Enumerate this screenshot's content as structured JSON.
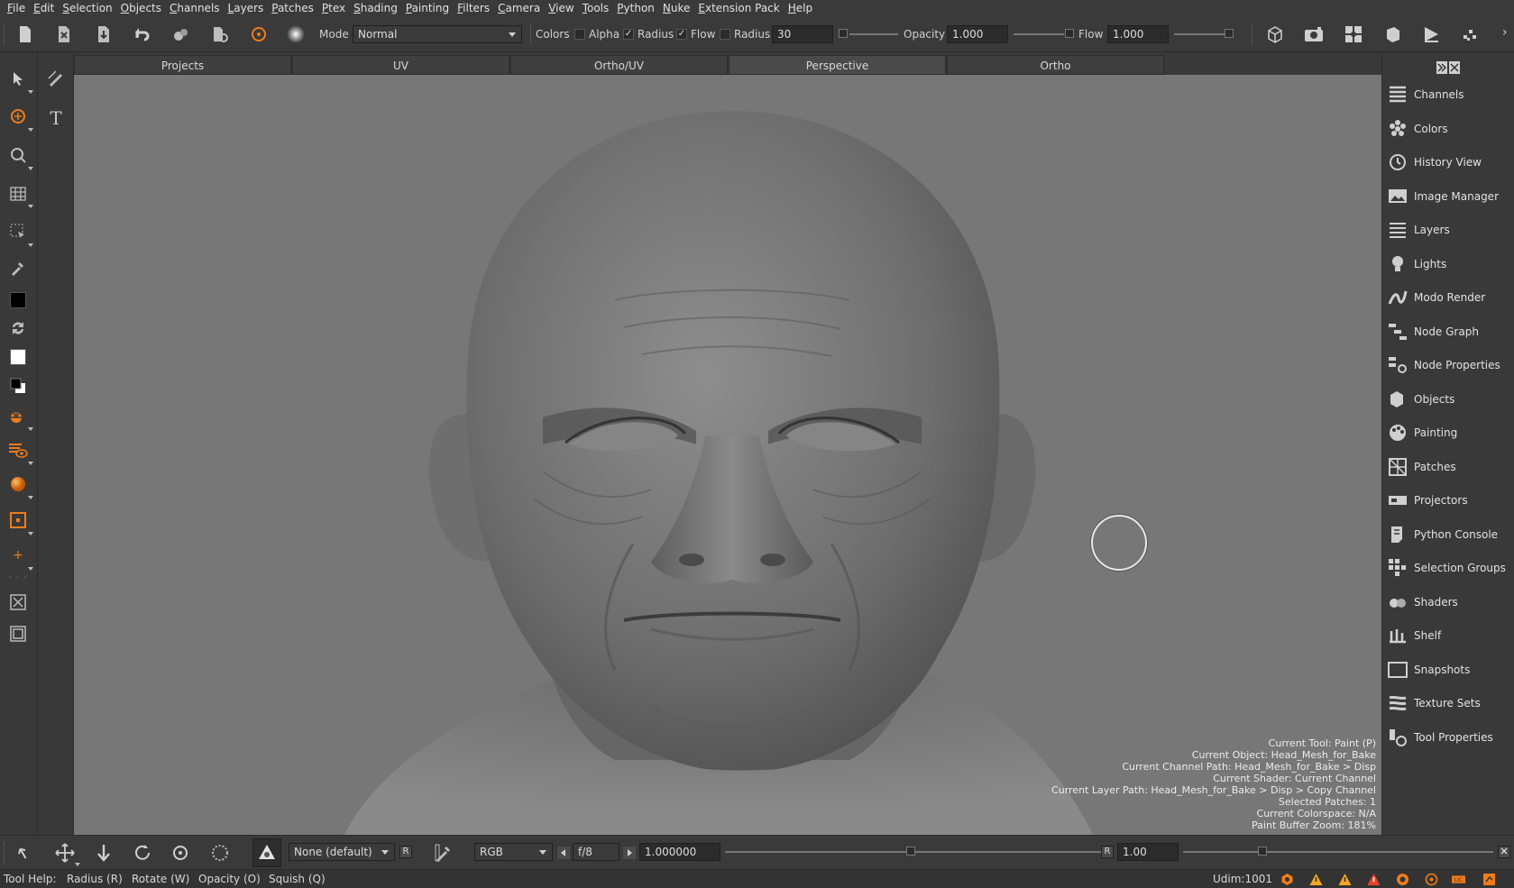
{
  "menu": [
    "File",
    "Edit",
    "Selection",
    "Objects",
    "Channels",
    "Layers",
    "Patches",
    "Ptex",
    "Shading",
    "Painting",
    "Filters",
    "Camera",
    "View",
    "Tools",
    "Python",
    "Nuke",
    "Extension Pack",
    "Help"
  ],
  "toolbar": {
    "mode_label": "Mode",
    "mode_value": "Normal",
    "colors_label": "Colors",
    "alpha_label": "Alpha",
    "radius_chk_label": "Radius",
    "flow_chk_label": "Flow",
    "radius_label": "Radius",
    "radius_value": "30",
    "opacity_label": "Opacity",
    "opacity_value": "1.000",
    "flow_label": "Flow",
    "flow_value": "1.000",
    "alpha_checked": false,
    "radius_checked": true,
    "flow_checked": true
  },
  "tabs": [
    "Projects",
    "UV",
    "Ortho/UV",
    "Perspective",
    "Ortho"
  ],
  "active_tab": "Perspective",
  "hud": [
    "Current Tool: Paint (P)",
    "Current Object: Head_Mesh_for_Bake",
    "Current Channel Path: Head_Mesh_for_Bake > Disp",
    "Current Shader: Current Channel",
    "Current Layer Path: Head_Mesh_for_Bake > Disp > Copy Channel",
    "Selected Patches: 1",
    "Current Colorspace: N/A",
    "Paint Buffer Zoom: 181%"
  ],
  "right_panel": [
    {
      "label": "Channels",
      "icon": "channels-icon"
    },
    {
      "label": "Colors",
      "icon": "colors-icon"
    },
    {
      "label": "History View",
      "icon": "history-icon"
    },
    {
      "label": "Image Manager",
      "icon": "image-manager-icon"
    },
    {
      "label": "Layers",
      "icon": "layers-icon"
    },
    {
      "label": "Lights",
      "icon": "lights-icon"
    },
    {
      "label": "Modo Render",
      "icon": "modo-render-icon"
    },
    {
      "label": "Node Graph",
      "icon": "node-graph-icon"
    },
    {
      "label": "Node Properties",
      "icon": "node-properties-icon"
    },
    {
      "label": "Objects",
      "icon": "objects-icon"
    },
    {
      "label": "Painting",
      "icon": "painting-icon"
    },
    {
      "label": "Patches",
      "icon": "patches-icon"
    },
    {
      "label": "Projectors",
      "icon": "projectors-icon"
    },
    {
      "label": "Python Console",
      "icon": "python-console-icon"
    },
    {
      "label": "Selection Groups",
      "icon": "selection-groups-icon"
    },
    {
      "label": "Shaders",
      "icon": "shaders-icon"
    },
    {
      "label": "Shelf",
      "icon": "shelf-icon"
    },
    {
      "label": "Snapshots",
      "icon": "snapshots-icon"
    },
    {
      "label": "Texture Sets",
      "icon": "texture-sets-icon"
    },
    {
      "label": "Tool Properties",
      "icon": "tool-properties-icon"
    }
  ],
  "bottom": {
    "lut_value": "None (default)",
    "r_label": "R",
    "channel_value": "RGB",
    "fstop_value": "f/8",
    "exposure_value": "1.000000",
    "gain_r_label": "R",
    "gamma_value": "1.00"
  },
  "status": {
    "tool_help": "Tool Help:",
    "hints": [
      "Radius (R)",
      "Rotate (W)",
      "Opacity (O)",
      "Squish (Q)"
    ],
    "udim": "Udim:1001"
  },
  "colors": {
    "accent": "#f07c1a",
    "viewport_bg": "#777777",
    "panel_bg": "#393939"
  }
}
